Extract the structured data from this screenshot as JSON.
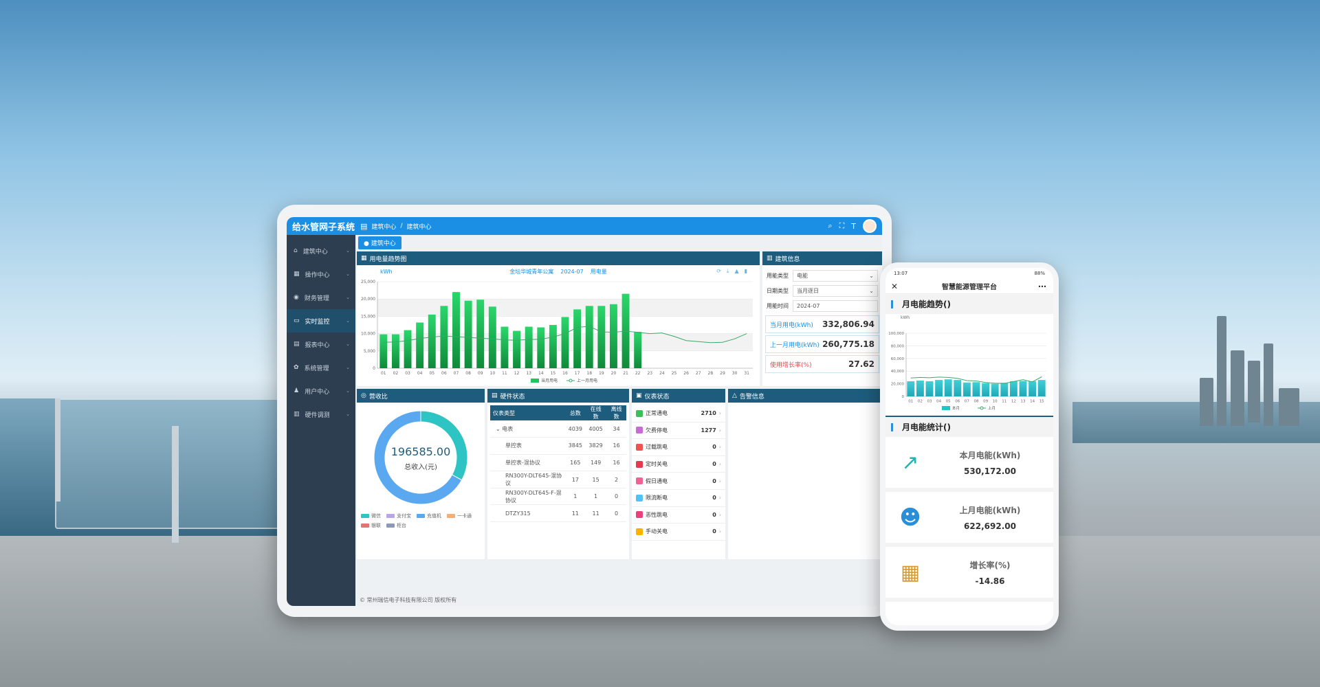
{
  "admin": {
    "app_title": "给水管网子系统",
    "breadcrumb": [
      "建筑中心",
      "/",
      "建筑中心"
    ],
    "sidebar": [
      {
        "label": "建筑中心",
        "icon": "home-icon"
      },
      {
        "label": "操作中心",
        "icon": "grid-icon"
      },
      {
        "label": "财务管理",
        "icon": "finance-icon"
      },
      {
        "label": "实时监控",
        "icon": "monitor-icon",
        "active": true
      },
      {
        "label": "报表中心",
        "icon": "report-icon"
      },
      {
        "label": "系统管理",
        "icon": "gear-icon"
      },
      {
        "label": "用户中心",
        "icon": "user-icon"
      },
      {
        "label": "硬件调测",
        "icon": "hardware-icon"
      }
    ],
    "active_tab": "建筑中心",
    "trend_panel": {
      "title": "用电量趋势图",
      "chart_caption": [
        "金坛华城青年公寓",
        "2024-07",
        "用电量"
      ]
    },
    "building_info": {
      "title": "建筑信息",
      "fields": [
        {
          "label": "用能类型",
          "value": "电能"
        },
        {
          "label": "日期类型",
          "value": "当月逐日"
        },
        {
          "label": "用能时间",
          "value": "2024-07"
        }
      ],
      "stats": [
        {
          "label": "当月用电(kWh)",
          "value": "332,806.94",
          "color": "#1a8fe3"
        },
        {
          "label": "上一月用电(kWh)",
          "value": "260,775.18",
          "color": "#1a8fe3"
        },
        {
          "label": "使用增长率(%)",
          "value": "27.62",
          "color": "#e04848"
        }
      ]
    },
    "revenue": {
      "title": "营收比",
      "total": "196585.00",
      "total_label": "总收入(元)",
      "legend": [
        {
          "name": "微信",
          "color": "#2ec4c4"
        },
        {
          "name": "支付宝",
          "color": "#b9a6e8"
        },
        {
          "name": "充值机",
          "color": "#5aa9f0"
        },
        {
          "name": "一卡通",
          "color": "#f0b07a"
        },
        {
          "name": "银联",
          "color": "#e57373"
        },
        {
          "name": "柜台",
          "color": "#8c9bb5"
        }
      ]
    },
    "hardware": {
      "title": "硬件状态",
      "headers": [
        "仪表类型",
        "总数",
        "在线数",
        "离线数"
      ],
      "rows": [
        {
          "name": "电表",
          "total": "4039",
          "online": "4005",
          "offline": "34",
          "expand": true
        },
        {
          "name": "单控表",
          "total": "3845",
          "online": "3829",
          "offline": "16"
        },
        {
          "name": "单控表-混协议",
          "total": "165",
          "online": "149",
          "offline": "16"
        },
        {
          "name": "RN300Y-DLT645-混协议",
          "total": "17",
          "online": "15",
          "offline": "2"
        },
        {
          "name": "RN300Y-DLT645-F-混协议",
          "total": "1",
          "online": "1",
          "offline": "0"
        },
        {
          "name": "DTZY315",
          "total": "11",
          "online": "11",
          "offline": "0"
        }
      ]
    },
    "meter_status": {
      "title": "仪表状态",
      "rows": [
        {
          "label": "正常通电",
          "count": "2710",
          "color": "#3bbf5a"
        },
        {
          "label": "欠费停电",
          "count": "1277",
          "color": "#c86ad8"
        },
        {
          "label": "过载跳电",
          "count": "0",
          "color": "#ef5350"
        },
        {
          "label": "定时关电",
          "count": "0",
          "color": "#e53950"
        },
        {
          "label": "假日通电",
          "count": "0",
          "color": "#f06292"
        },
        {
          "label": "限流断电",
          "count": "0",
          "color": "#4fc3f7"
        },
        {
          "label": "恶性跳电",
          "count": "0",
          "color": "#ec407a"
        },
        {
          "label": "手动关电",
          "count": "0",
          "color": "#ffb300"
        }
      ]
    },
    "alarm": {
      "title": "告警信息"
    },
    "footer": "© 常州瑞信电子科技有限公司 版权所有"
  },
  "phone": {
    "status_time": "13:07",
    "battery": "88%",
    "title": "智慧能源管理平台",
    "trend_title": "月电能趋势()",
    "stats_title": "月电能统计()",
    "cards": [
      {
        "label": "本月电能(kWh)",
        "value": "530,172.00",
        "icon": "growth-chart-icon",
        "color": "#1fb3b3"
      },
      {
        "label": "上月电能(kWh)",
        "value": "622,692.00",
        "icon": "user-report-icon",
        "color": "#2b8fd8"
      },
      {
        "label": "增长率(%)",
        "value": "-14.86",
        "icon": "building-icon",
        "color": "#d99a2b"
      }
    ]
  },
  "chart_data": [
    {
      "type": "bar",
      "ylabel": "kWh",
      "ylim": [
        0,
        25000
      ],
      "yticks": [
        "0",
        "5,000",
        "10,000",
        "15,000",
        "20,000",
        "25,000"
      ],
      "categories": [
        "01",
        "02",
        "03",
        "04",
        "05",
        "06",
        "07",
        "08",
        "09",
        "10",
        "11",
        "12",
        "13",
        "14",
        "15",
        "16",
        "17",
        "18",
        "19",
        "20",
        "21",
        "22",
        "23",
        "24",
        "25",
        "26",
        "27",
        "28",
        "29",
        "30",
        "31"
      ],
      "series": [
        {
          "name": "当月用电",
          "kind": "bar",
          "color": "#22c55e",
          "values": [
            9800,
            9800,
            11000,
            13200,
            15500,
            18000,
            22000,
            19500,
            19800,
            17800,
            12000,
            10800,
            12000,
            11800,
            12500,
            14800,
            17000,
            18000,
            18000,
            18500,
            21500,
            10500,
            null,
            null,
            null,
            null,
            null,
            null,
            null,
            null,
            null
          ]
        },
        {
          "name": "上一月用电",
          "kind": "line",
          "color": "#3aa86b",
          "values": [
            7500,
            7600,
            8000,
            8600,
            9000,
            9300,
            9100,
            8900,
            8700,
            8500,
            8200,
            8100,
            8300,
            8400,
            9000,
            10000,
            11800,
            12100,
            10500,
            10400,
            10700,
            10400,
            10000,
            10200,
            9200,
            8000,
            7700,
            7400,
            7500,
            8500,
            10000
          ]
        }
      ],
      "legend_position": "bottom"
    },
    {
      "type": "pie",
      "title": "营收比",
      "values": [
        {
          "name": "微信",
          "share": 0.33
        },
        {
          "name": "充值机",
          "share": 0.67
        }
      ]
    },
    {
      "type": "bar",
      "ylabel": "kWh",
      "ylim": [
        0,
        100000
      ],
      "yticks": [
        "0",
        "20,000",
        "40,000",
        "60,000",
        "80,000",
        "100,000"
      ],
      "categories": [
        "01",
        "02",
        "03",
        "04",
        "05",
        "06",
        "07",
        "08",
        "09",
        "10",
        "11",
        "12",
        "13",
        "14",
        "15"
      ],
      "series": [
        {
          "name": "本月",
          "kind": "bar",
          "color": "#2bc0c8",
          "values": [
            24000,
            25000,
            24000,
            26000,
            27000,
            26000,
            22000,
            22500,
            21000,
            20000,
            21500,
            24000,
            24500,
            24000,
            26000
          ]
        },
        {
          "name": "上月",
          "kind": "line",
          "color": "#3aa86b",
          "values": [
            29000,
            30000,
            29500,
            30500,
            30000,
            28500,
            25000,
            24500,
            22000,
            21000,
            20500,
            23500,
            26500,
            23000,
            31000
          ]
        }
      ],
      "legend_position": "bottom"
    }
  ]
}
